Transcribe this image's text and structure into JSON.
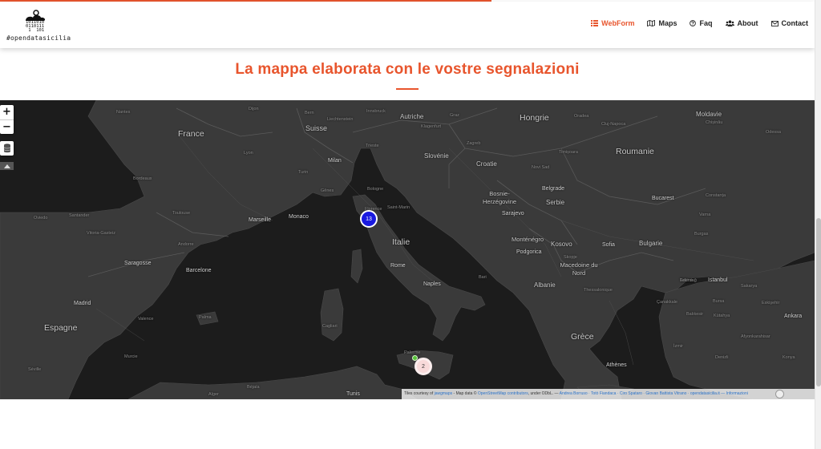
{
  "header": {
    "logo_text": "#opendatasicilia",
    "logo_bits": "1011010\n0110111\n 1  101",
    "menu": [
      {
        "label": "WebForm",
        "icon": "list-icon",
        "active": true
      },
      {
        "label": "Maps",
        "icon": "map-icon",
        "active": false
      },
      {
        "label": "Faq",
        "icon": "question-circle-icon",
        "active": false
      },
      {
        "label": "About",
        "icon": "users-icon",
        "active": false
      },
      {
        "label": "Contact",
        "icon": "envelope-icon",
        "active": false
      }
    ]
  },
  "section": {
    "title": "La mappa elaborata con le vostre segnalazioni"
  },
  "map": {
    "controls": {
      "zoom_in": "+",
      "zoom_out": "−"
    },
    "clusters": [
      {
        "count": "13",
        "color": "#1a1ae0"
      },
      {
        "count": "2",
        "color": "#f8dada"
      }
    ],
    "countries": [
      "France",
      "Suisse",
      "Autriche",
      "Hongrie",
      "Moldavie",
      "Roumanie",
      "Slovénie",
      "Croatie",
      "Bosnie-Herzégovine",
      "Serbie",
      "Italie",
      "Monténégro",
      "Kosovo",
      "Bulgarie",
      "Macedoine du Nord",
      "Albanie",
      "Espagne",
      "Grèce"
    ],
    "cities": [
      "Nantes",
      "Dijon",
      "Bern",
      "Liechtenstein",
      "Innsbruck",
      "Graz",
      "Klagenfurt",
      "Lyon",
      "Milan",
      "Trieste",
      "Turin",
      "Zagreb",
      "Bordeaux",
      "Gênes",
      "Bologne",
      "Belgrade",
      "Bucarest",
      "Toulouse",
      "Florence",
      "Saint-Marin",
      "Sarajevo",
      "Marseille",
      "Monaco",
      "Santander",
      "Vitoria-Gasteiz",
      "Andorre",
      "Podgorica",
      "Sofia",
      "Saragosse",
      "Barcelone",
      "Rome",
      "Skopje",
      "Naples",
      "Bari",
      "Edirne",
      "Istanbul",
      "Madrid",
      "Valence",
      "Palma",
      "Cagliari",
      "Thessalonique",
      "Çanakkale",
      "Bursa",
      "Balıkesir",
      "Ankara",
      "Murcie",
      "Palerme",
      "İzmir",
      "Afyonkarahisar",
      "Séville",
      "Athènes",
      "Denizli",
      "Konya",
      "Alger",
      "Béjaïa",
      "Tunis",
      "Oviedo",
      "Oradea",
      "Cluj-Napoca",
      "Odessa",
      "Chișinău",
      "Timișoara",
      "Novi Sad",
      "Constanța",
      "Varna",
      "Burgas",
      "Tekirdağ",
      "Sakarya",
      "Eskişehir",
      "Kütahya"
    ],
    "attribution": {
      "prefix": "Tiles courtesy of",
      "jawg": "jawgmaps",
      "mapdata": "- Map data ©",
      "osm": "OpenStreetMap contributors",
      "license": ", under ODbL. —",
      "authors": "Andrea Borruso · Totò Fiandaca · Ciro Spataro · Giovan Battista Vitrano · opendatasicilia.it",
      "more": "— Informazioni"
    }
  }
}
